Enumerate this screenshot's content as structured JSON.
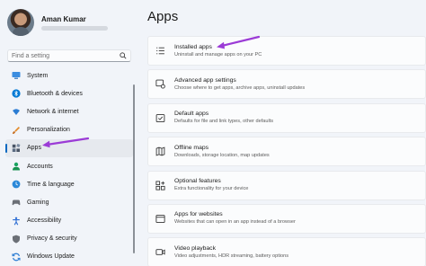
{
  "profile": {
    "name": "Aman Kumar"
  },
  "search": {
    "placeholder": "Find a setting"
  },
  "sidebar": {
    "items": [
      {
        "label": "System",
        "icon": "monitor-icon",
        "color": "#0078d4"
      },
      {
        "label": "Bluetooth & devices",
        "icon": "bluetooth-icon",
        "color": "#0078d4"
      },
      {
        "label": "Network & internet",
        "icon": "wifi-icon",
        "color": "#2b7cd3"
      },
      {
        "label": "Personalization",
        "icon": "brush-icon",
        "color": "#e38b2b"
      },
      {
        "label": "Apps",
        "icon": "apps-icon",
        "color": "#4a5566",
        "active": true
      },
      {
        "label": "Accounts",
        "icon": "person-icon",
        "color": "#1aa260"
      },
      {
        "label": "Time & language",
        "icon": "globe-clock-icon",
        "color": "#2b88d8"
      },
      {
        "label": "Gaming",
        "icon": "gamepad-icon",
        "color": "#6b6f76"
      },
      {
        "label": "Accessibility",
        "icon": "accessibility-icon",
        "color": "#2b6cd3"
      },
      {
        "label": "Privacy & security",
        "icon": "shield-icon",
        "color": "#6b6f76"
      },
      {
        "label": "Windows Update",
        "icon": "sync-icon",
        "color": "#2b7cd3"
      }
    ]
  },
  "main": {
    "title": "Apps",
    "cards": [
      {
        "title": "Installed apps",
        "desc": "Uninstall and manage apps on your PC",
        "icon": "list-icon"
      },
      {
        "title": "Advanced app settings",
        "desc": "Choose where to get apps, archive apps, uninstall updates",
        "icon": "app-settings-icon"
      },
      {
        "title": "Default apps",
        "desc": "Defaults for file and link types, other defaults",
        "icon": "default-apps-icon"
      },
      {
        "title": "Offline maps",
        "desc": "Downloads, storage location, map updates",
        "icon": "map-icon"
      },
      {
        "title": "Optional features",
        "desc": "Extra functionality for your device",
        "icon": "grid-plus-icon"
      },
      {
        "title": "Apps for websites",
        "desc": "Websites that can open in an app instead of a browser",
        "icon": "app-window-icon"
      },
      {
        "title": "Video playback",
        "desc": "Video adjustments, HDR streaming, battery options",
        "icon": "video-icon"
      }
    ]
  },
  "colors": {
    "accent": "#0067c0",
    "annotation": "#9b3bd6"
  }
}
